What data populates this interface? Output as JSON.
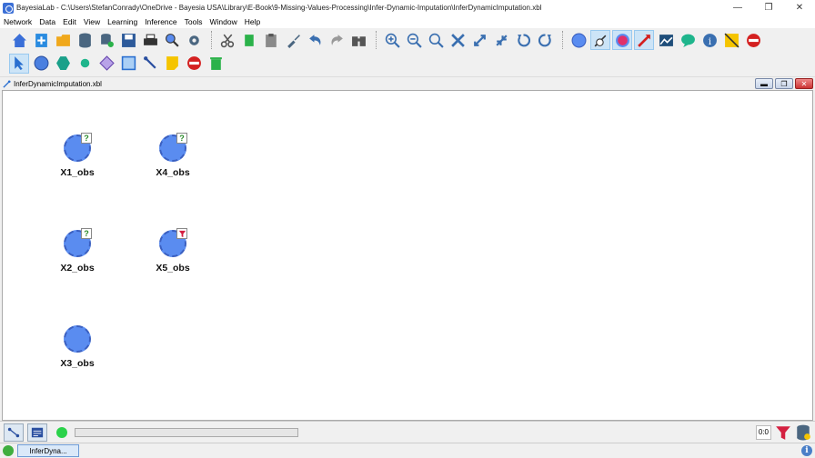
{
  "window": {
    "title": "BayesiaLab - C:\\Users\\StefanConrady\\OneDrive - Bayesia USA\\Library\\E-Book\\9-Missing-Values-Processing\\Infer-Dynamic-Imputation\\InferDynamicImputation.xbl",
    "minimize": "—",
    "restore": "❐",
    "close": "✕"
  },
  "menu": [
    "Network",
    "Data",
    "Edit",
    "View",
    "Learning",
    "Inference",
    "Tools",
    "Window",
    "Help"
  ],
  "document": {
    "title": "InferDynamicImputation.xbl"
  },
  "nodes": [
    {
      "label": "X1_obs",
      "badge": "?"
    },
    {
      "label": "X4_obs",
      "badge": "?"
    },
    {
      "label": "X2_obs",
      "badge": "?"
    },
    {
      "label": "X5_obs",
      "badge": "filter"
    },
    {
      "label": "X3_obs",
      "badge": ""
    }
  ],
  "status": {
    "counter": "0:0",
    "progress": 0
  },
  "taskbar": {
    "item": "InferDyna..."
  },
  "colors": {
    "node_fill": "#5a8cf0",
    "accent": "#3a5fc0"
  }
}
